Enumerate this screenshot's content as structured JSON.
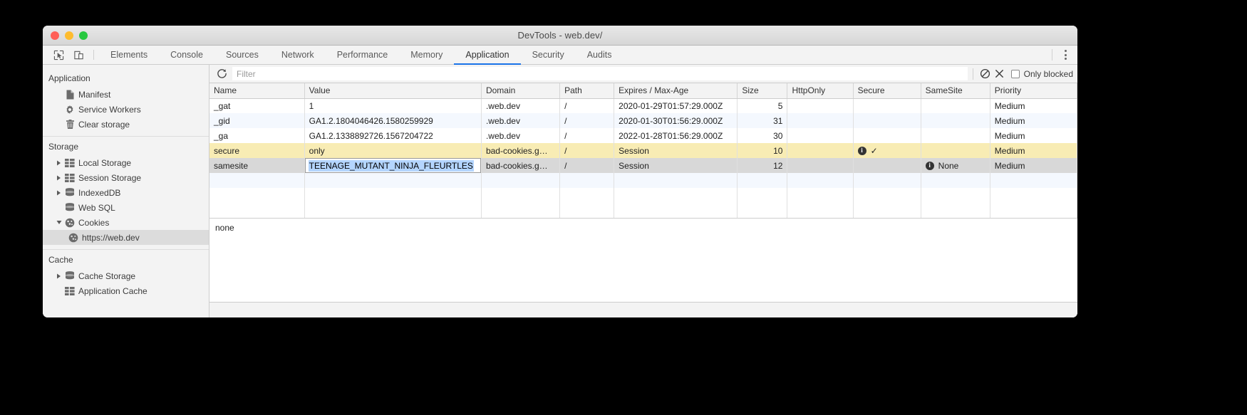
{
  "window": {
    "title": "DevTools - web.dev/",
    "traffic_lights": [
      "close-red",
      "minimize-yellow",
      "maximize-green"
    ]
  },
  "tabbar": {
    "inspect_icon": "inspect-element-icon",
    "device_icon": "toggle-device-toolbar-icon",
    "tabs": [
      {
        "label": "Elements",
        "active": false
      },
      {
        "label": "Console",
        "active": false
      },
      {
        "label": "Sources",
        "active": false
      },
      {
        "label": "Network",
        "active": false
      },
      {
        "label": "Performance",
        "active": false
      },
      {
        "label": "Memory",
        "active": false
      },
      {
        "label": "Application",
        "active": true
      },
      {
        "label": "Security",
        "active": false
      },
      {
        "label": "Audits",
        "active": false
      }
    ],
    "more_icon": "kebab-menu-icon",
    "active_underline_color": "#1a73e8"
  },
  "sidebar": {
    "sections": [
      {
        "title": "Application",
        "items": [
          {
            "label": "Manifest",
            "icon": "manifest-document-icon",
            "twisty": "none",
            "indent": 1,
            "selected": false
          },
          {
            "label": "Service Workers",
            "icon": "gear-icon",
            "twisty": "none",
            "indent": 1,
            "selected": false
          },
          {
            "label": "Clear storage",
            "icon": "trash-icon",
            "twisty": "none",
            "indent": 1,
            "selected": false
          }
        ]
      },
      {
        "title": "Storage",
        "items": [
          {
            "label": "Local Storage",
            "icon": "table-grid-icon",
            "twisty": "collapsed",
            "indent": 1,
            "selected": false
          },
          {
            "label": "Session Storage",
            "icon": "table-grid-icon",
            "twisty": "collapsed",
            "indent": 1,
            "selected": false
          },
          {
            "label": "IndexedDB",
            "icon": "database-icon",
            "twisty": "collapsed",
            "indent": 1,
            "selected": false
          },
          {
            "label": "Web SQL",
            "icon": "database-icon",
            "twisty": "none",
            "indent": 1,
            "selected": false
          },
          {
            "label": "Cookies",
            "icon": "cookie-icon",
            "twisty": "expanded",
            "indent": 1,
            "selected": false
          },
          {
            "label": "https://web.dev",
            "icon": "cookie-icon",
            "twisty": "none",
            "indent": 2,
            "selected": true
          }
        ]
      },
      {
        "title": "Cache",
        "items": [
          {
            "label": "Cache Storage",
            "icon": "database-icon",
            "twisty": "collapsed",
            "indent": 1,
            "selected": false
          },
          {
            "label": "Application Cache",
            "icon": "table-grid-icon",
            "twisty": "none",
            "indent": 1,
            "selected": false
          }
        ]
      }
    ]
  },
  "toolbar": {
    "refresh_icon": "refresh-icon",
    "filter_placeholder": "Filter",
    "filter_value": "",
    "clear_filter_icon": "block-clear-icon",
    "delete_icon": "close-x-icon",
    "only_blocked_label": "Only blocked",
    "only_blocked_checked": false
  },
  "table": {
    "columns": [
      "Name",
      "Value",
      "Domain",
      "Path",
      "Expires / Max-Age",
      "Size",
      "HttpOnly",
      "Secure",
      "SameSite",
      "Priority"
    ],
    "rows": [
      {
        "style": "odd",
        "name": "_gat",
        "value": "1",
        "domain": ".web.dev",
        "path": "/",
        "expires": "2020-01-29T01:57:29.000Z",
        "size": "5",
        "httponly": "",
        "secure": "",
        "samesite": "",
        "priority": "Medium"
      },
      {
        "style": "even",
        "name": "_gid",
        "value": "GA1.2.1804046426.1580259929",
        "domain": ".web.dev",
        "path": "/",
        "expires": "2020-01-30T01:56:29.000Z",
        "size": "31",
        "httponly": "",
        "secure": "",
        "samesite": "",
        "priority": "Medium"
      },
      {
        "style": "odd",
        "name": "_ga",
        "value": "GA1.2.1338892726.1567204722",
        "domain": ".web.dev",
        "path": "/",
        "expires": "2022-01-28T01:56:29.000Z",
        "size": "30",
        "httponly": "",
        "secure": "",
        "samesite": "",
        "priority": "Medium"
      },
      {
        "style": "highlight",
        "name": "secure",
        "value": "only",
        "domain": "bad-cookies.g…",
        "path": "/",
        "expires": "Session",
        "size": "10",
        "httponly": "",
        "secure": "info-badge-check",
        "samesite": "",
        "priority": "Medium"
      },
      {
        "style": "selected",
        "name": "samesite",
        "value": "TEENAGE_MUTANT_NINJA_FLEURTLES",
        "editing": true,
        "domain": "bad-cookies.g…",
        "path": "/",
        "expires": "Session",
        "size": "12",
        "httponly": "",
        "secure": "",
        "samesite": "info-badge-none",
        "samesite_text": "None",
        "priority": "Medium"
      }
    ],
    "blank_rows": [
      {
        "style": "even"
      },
      {
        "style": "odd"
      },
      {
        "style": "odd"
      }
    ]
  },
  "preview": {
    "text": "none"
  },
  "colors": {
    "accent": "#1a73e8",
    "row_highlight": "#f8ecb4",
    "row_selected": "#d8d8d8",
    "row_alt": "#f4f8fe",
    "selection_blue": "#b4d5fe"
  }
}
